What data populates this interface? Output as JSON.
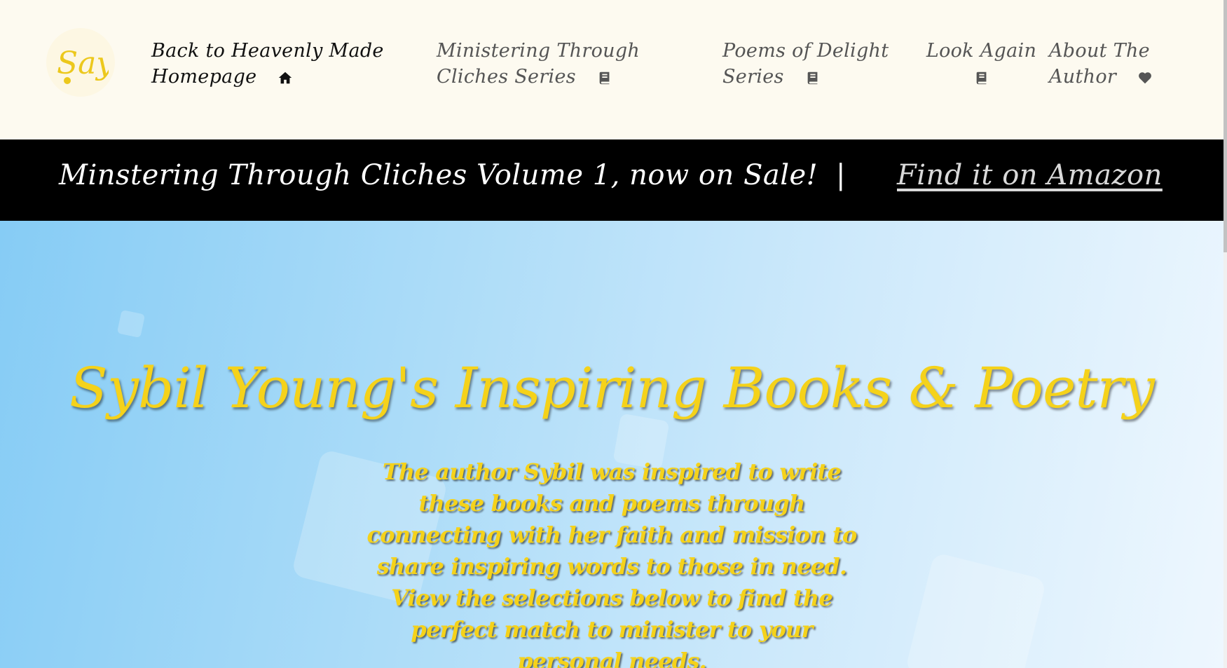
{
  "nav": {
    "logo_text": "Say",
    "items": [
      {
        "label": "Back to Heavenly Made Homepage",
        "icon": "home-icon"
      },
      {
        "label": "Ministering Through Cliches Series",
        "icon": "book-icon"
      },
      {
        "label": "Poems of Delight Series",
        "icon": "book-icon"
      },
      {
        "label": "Look Again",
        "icon": "book-icon"
      },
      {
        "label": "About The Author",
        "icon": "heart-icon"
      }
    ]
  },
  "promo": {
    "text": "Minstering Through Cliches Volume 1, now on Sale!",
    "separator": "|",
    "link": "Find it on Amazon"
  },
  "hero": {
    "title": "Sybil Young's Inspiring Books & Poetry",
    "description": "The author Sybil was inspired to write these books and poems through connecting with her faith and mission to share inspiring words to those in need. View the selections below to find the perfect match to minister to your personal needs."
  },
  "colors": {
    "nav_background": "#fdfaf0",
    "banner_background": "#000000",
    "accent_gold": "#f5d21a",
    "hero_gradient_start": "#86ccf5",
    "hero_gradient_end": "#eef7fe"
  }
}
